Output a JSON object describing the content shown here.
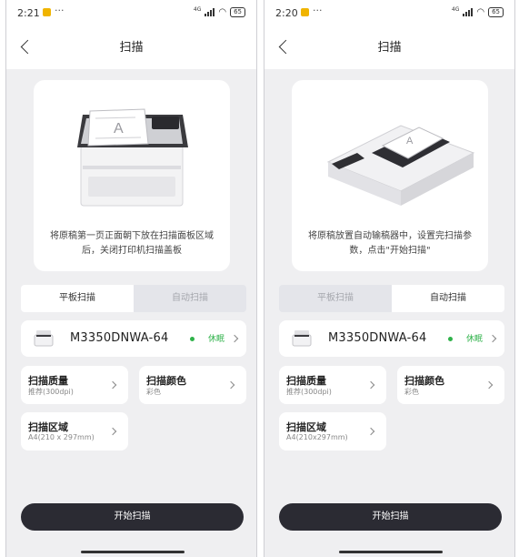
{
  "phones": [
    {
      "status_bar": {
        "time": "2:21",
        "dots": "···",
        "network": "4G",
        "battery": "65"
      },
      "nav": {
        "title": "扫描"
      },
      "hero": {
        "caption": "将原稿第一页正面朝下放在扫描面板区域后，关闭打印机扫描盖板"
      },
      "tabs": [
        {
          "label": "平板扫描",
          "active": true
        },
        {
          "label": "自动扫描",
          "active": false
        }
      ],
      "printer": {
        "name": "M3350DNWA-64",
        "status": "休眠"
      },
      "settings": [
        {
          "title": "扫描质量",
          "value": "推荐(300dpi)"
        },
        {
          "title": "扫描颜色",
          "value": "彩色"
        },
        {
          "title": "扫描区域",
          "value": "A4(210 x 297mm)"
        }
      ],
      "start_label": "开始扫描"
    },
    {
      "status_bar": {
        "time": "2:20",
        "dots": "···",
        "network": "4G",
        "battery": "65"
      },
      "nav": {
        "title": "扫描"
      },
      "hero": {
        "caption": "将原稿放置自动输稿器中，设置完扫描参数，点击\"开始扫描\""
      },
      "tabs": [
        {
          "label": "平板扫描",
          "active": false
        },
        {
          "label": "自动扫描",
          "active": true
        }
      ],
      "printer": {
        "name": "M3350DNWA-64",
        "status": "休眠"
      },
      "settings": [
        {
          "title": "扫描质量",
          "value": "推荐(300dpi)"
        },
        {
          "title": "扫描颜色",
          "value": "彩色"
        },
        {
          "title": "扫描区域",
          "value": "A4(210x297mm)"
        }
      ],
      "start_label": "开始扫描"
    }
  ],
  "colors": {
    "accent": "#2b2b33",
    "status_green": "#2fb24a",
    "background": "#efeff1"
  }
}
